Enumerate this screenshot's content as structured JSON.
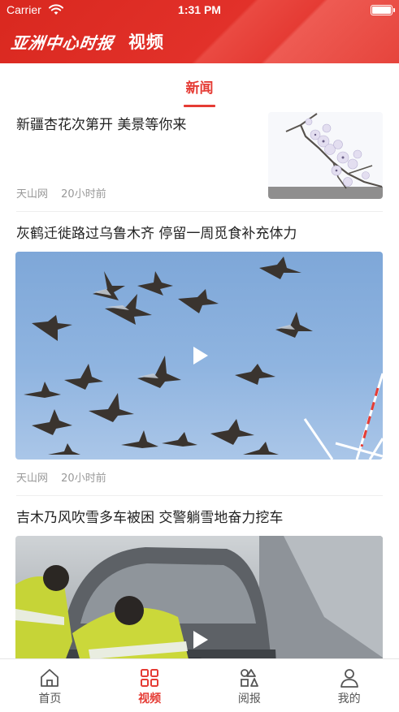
{
  "status_bar": {
    "carrier": "Carrier",
    "time": "1:31 PM"
  },
  "header": {
    "logo_text": "亚洲中心时报",
    "section_title": "视频"
  },
  "tabs": [
    {
      "label": "新闻",
      "active": true
    }
  ],
  "feed": [
    {
      "title": "新疆杏花次第开 美景等你来",
      "source": "天山网",
      "time": "20小时前",
      "layout": "thumbnail",
      "media": "apricot-blossom-photo"
    },
    {
      "title": "灰鹤迁徙路过乌鲁木齐 停留一周觅食补充体力",
      "source": "天山网",
      "time": "20小时前",
      "layout": "video",
      "media": "migrating-cranes-video"
    },
    {
      "title": "吉木乃风吹雪多车被困 交警躺雪地奋力挖车",
      "layout": "video",
      "media": "snowbound-car-video"
    }
  ],
  "bottom_nav": [
    {
      "label": "首页",
      "icon": "home-icon",
      "active": false
    },
    {
      "label": "视频",
      "icon": "grid-icon",
      "active": true
    },
    {
      "label": "阅报",
      "icon": "shapes-icon",
      "active": false
    },
    {
      "label": "我的",
      "icon": "person-icon",
      "active": false
    }
  ],
  "colors": {
    "brand_red": "#e53b34",
    "meta_gray": "#999999",
    "text": "#222222"
  }
}
